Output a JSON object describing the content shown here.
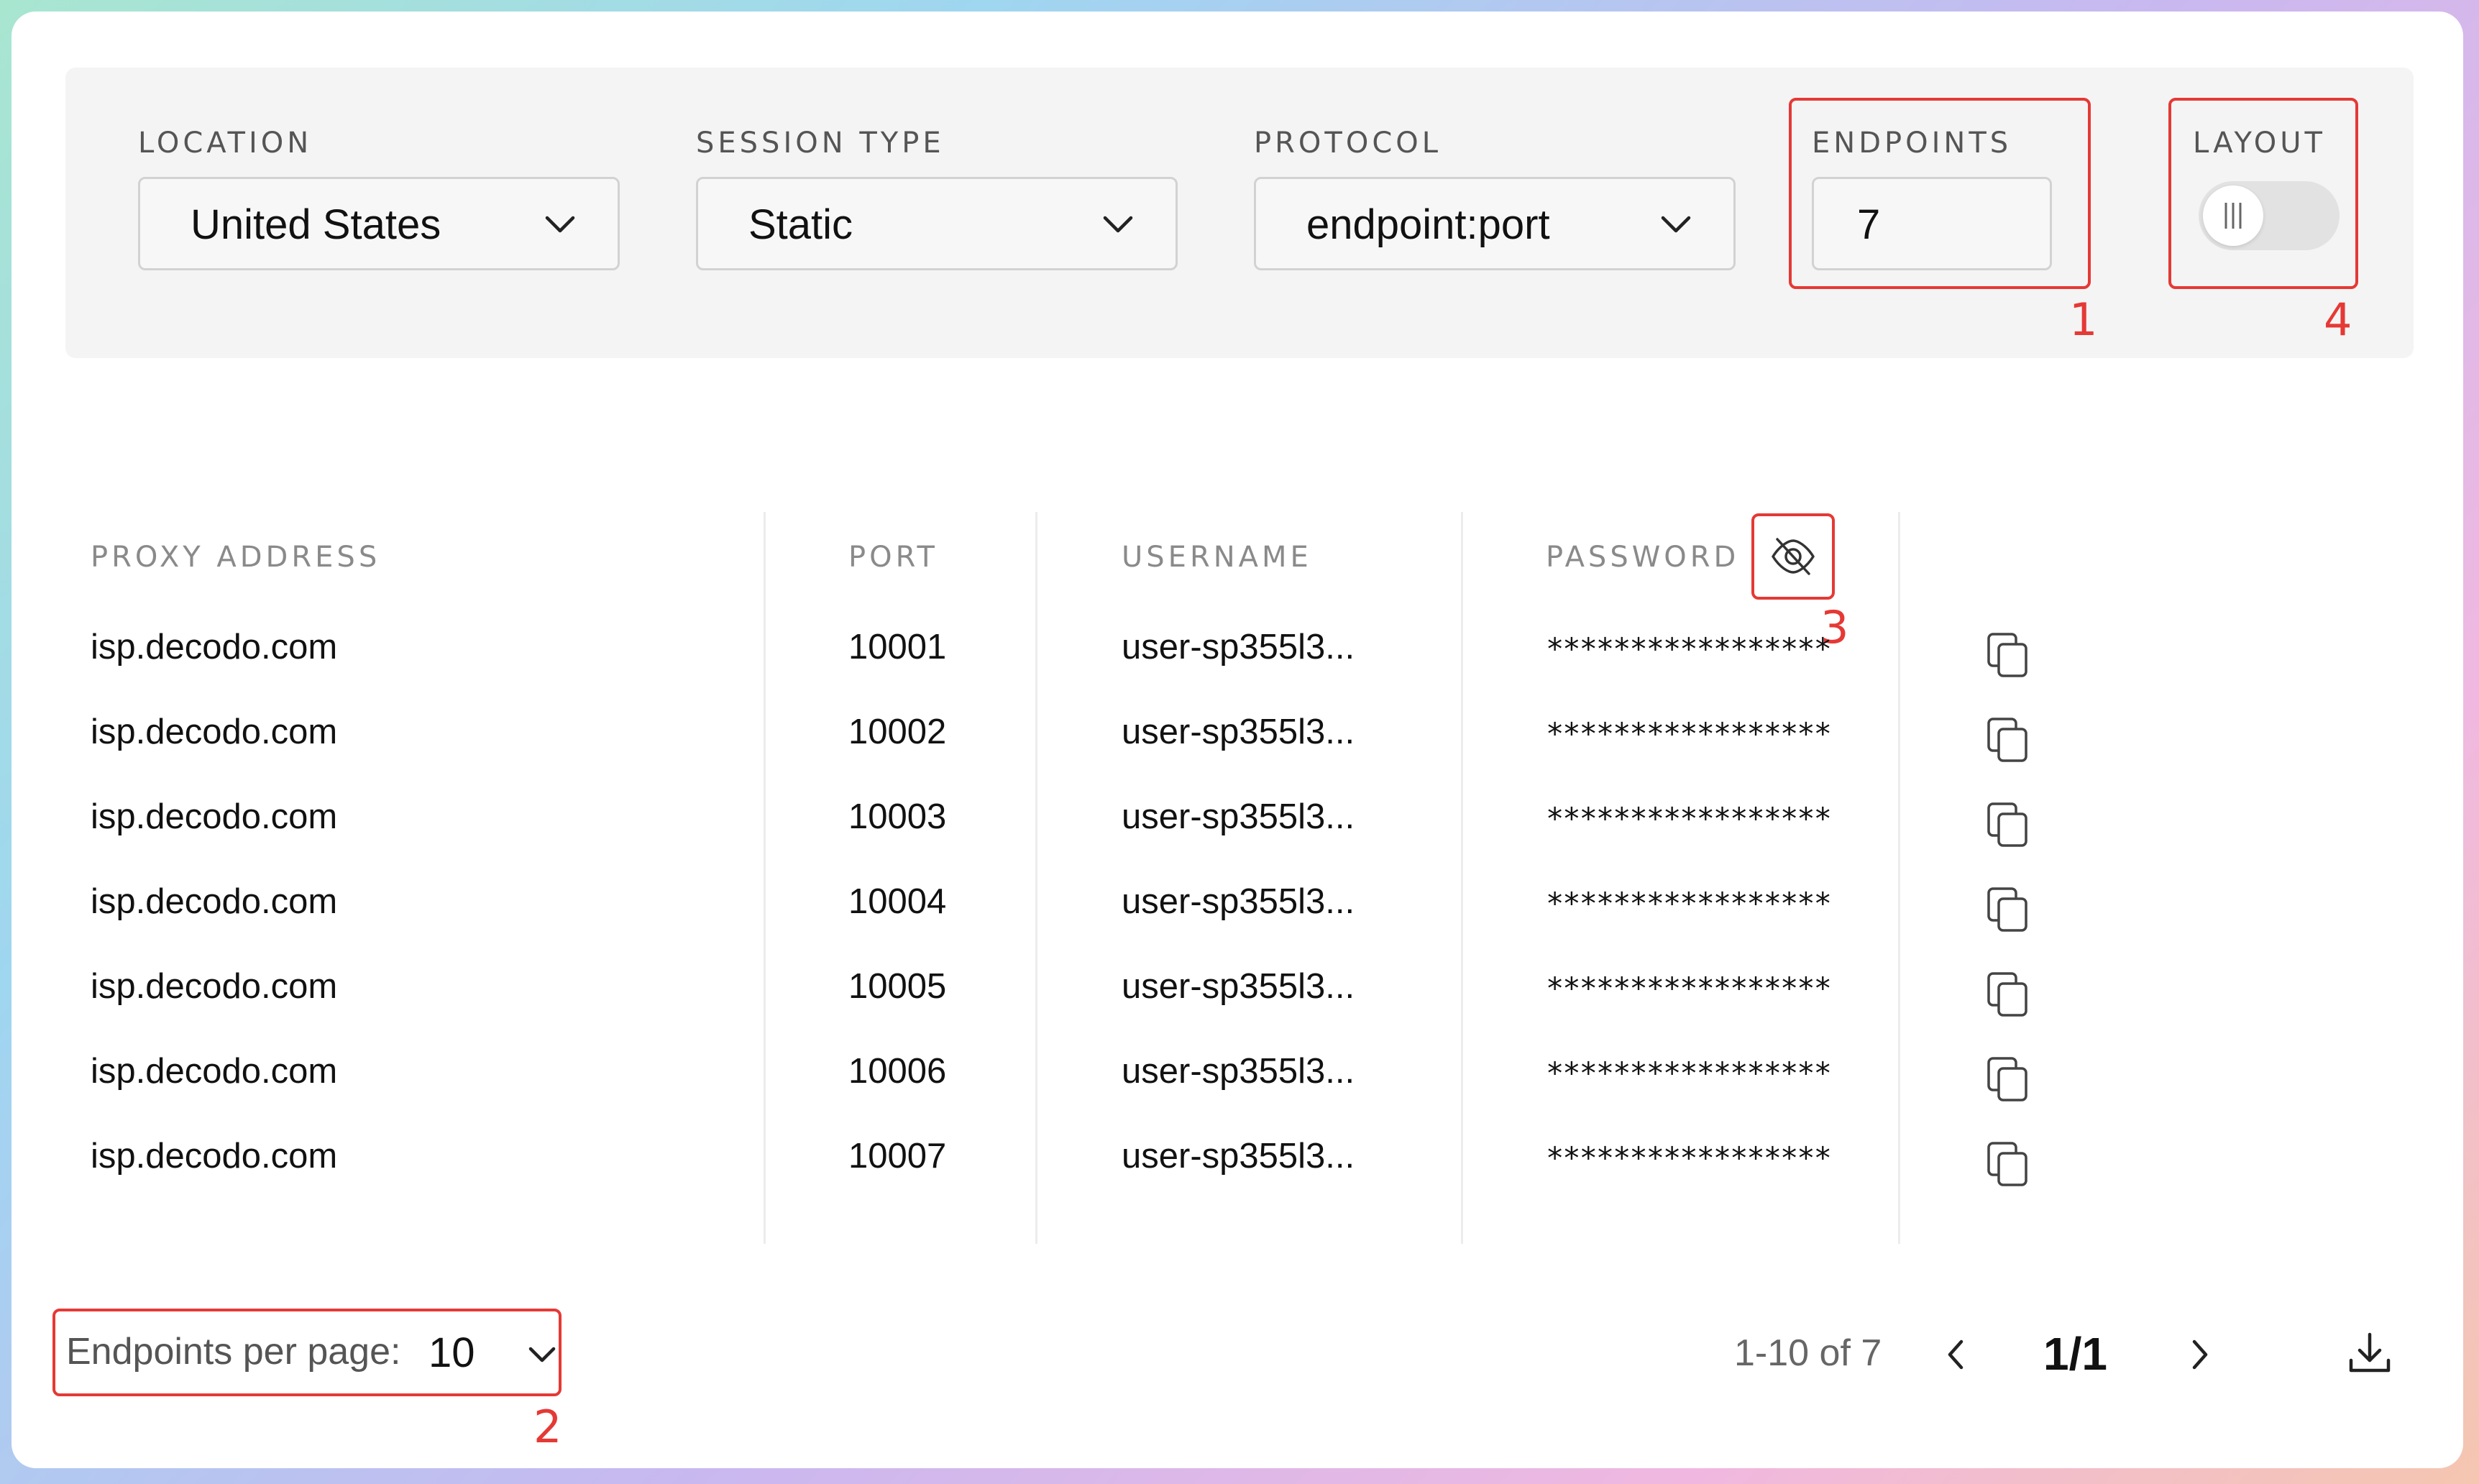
{
  "filters": {
    "location": {
      "label": "LOCATION",
      "value": "United States"
    },
    "session_type": {
      "label": "SESSION TYPE",
      "value": "Static"
    },
    "protocol": {
      "label": "PROTOCOL",
      "value": "endpoint:port"
    },
    "endpoints": {
      "label": "ENDPOINTS",
      "value": "7"
    },
    "layout": {
      "label": "LAYOUT",
      "toggle_on": false
    }
  },
  "annotations": {
    "n1": "1",
    "n2": "2",
    "n3": "3",
    "n4": "4"
  },
  "annotation_color": "#e53935",
  "table": {
    "headers": {
      "proxy": "PROXY ADDRESS",
      "port": "PORT",
      "username": "USERNAME",
      "password": "PASSWORD"
    },
    "rows": [
      {
        "proxy": "isp.decodo.com",
        "port": "10001",
        "username": "user-sp355l3...",
        "password": "*****************"
      },
      {
        "proxy": "isp.decodo.com",
        "port": "10002",
        "username": "user-sp355l3...",
        "password": "*****************"
      },
      {
        "proxy": "isp.decodo.com",
        "port": "10003",
        "username": "user-sp355l3...",
        "password": "*****************"
      },
      {
        "proxy": "isp.decodo.com",
        "port": "10004",
        "username": "user-sp355l3...",
        "password": "*****************"
      },
      {
        "proxy": "isp.decodo.com",
        "port": "10005",
        "username": "user-sp355l3...",
        "password": "*****************"
      },
      {
        "proxy": "isp.decodo.com",
        "port": "10006",
        "username": "user-sp355l3...",
        "password": "*****************"
      },
      {
        "proxy": "isp.decodo.com",
        "port": "10007",
        "username": "user-sp355l3...",
        "password": "*****************"
      }
    ]
  },
  "pagination": {
    "per_page_label": "Endpoints per page:",
    "per_page_value": "10",
    "range": "1-10 of 7",
    "page": "1/1"
  },
  "icons": {
    "password_toggle": "eye-off-icon",
    "copy": "copy-icon",
    "download": "download-icon",
    "prev": "chevron-left-icon",
    "next": "chevron-right-icon"
  }
}
